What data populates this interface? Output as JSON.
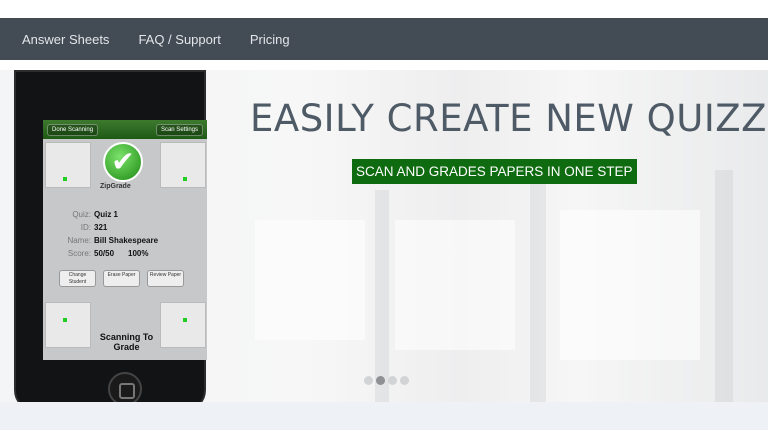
{
  "nav": {
    "items": [
      {
        "label": "Answer Sheets"
      },
      {
        "label": "FAQ / Support"
      },
      {
        "label": "Pricing"
      }
    ]
  },
  "hero": {
    "headline": "EASILY CREATE NEW QUIZZES",
    "subheadline": "SCAN AND GRADES PAPERS IN ONE STEP",
    "accent_color": "#0f6b10",
    "carousel": {
      "total": 4,
      "active": 2
    }
  },
  "phone_screen": {
    "done_button": "Done Scanning",
    "settings_button": "Scan Settings",
    "brand": "ZipGrade",
    "quiz_label": "Quiz:",
    "quiz_value": "Quiz 1",
    "id_label": "ID:",
    "id_value": "321",
    "name_label": "Name:",
    "name_value": "Bill Shakespeare",
    "score_label": "Score:",
    "score_value": "50/50",
    "percent_value": "100%",
    "buttons": [
      "Change Student",
      "Erase Paper",
      "Review Paper"
    ],
    "scanning_label": "Scanning To Grade"
  },
  "colors": {
    "nav_bg": "#434b55",
    "nav_text": "#e3e6ea",
    "headline": "#4e5a66"
  }
}
